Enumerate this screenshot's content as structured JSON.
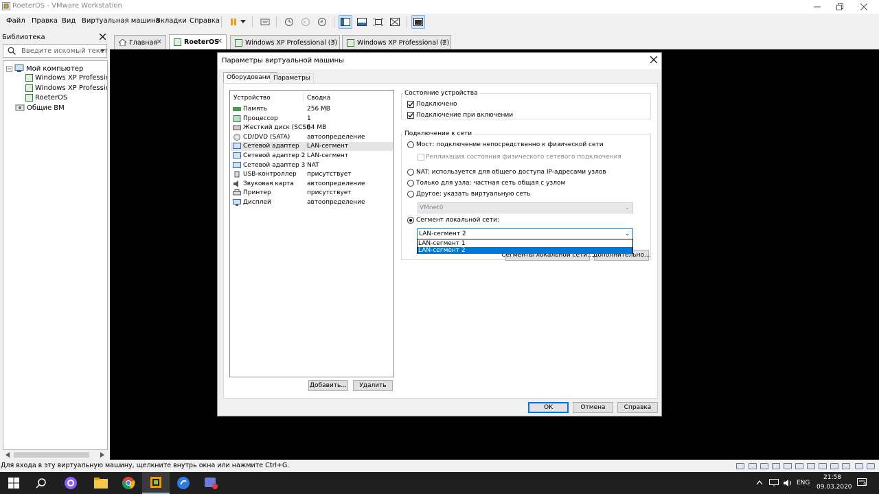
{
  "window": {
    "title": "RoeterOS - VMware Workstation"
  },
  "menu": {
    "items": [
      "Файл",
      "Правка",
      "Вид",
      "Виртуальная машина",
      "Вкладки",
      "Справка"
    ]
  },
  "library": {
    "title": "Библиотека",
    "search_placeholder": "Введите искомый текст",
    "tree": {
      "root": "Мой компьютер",
      "children": [
        "Windows XP Professional",
        "Windows XP Professional",
        "RoeterOS"
      ],
      "shared": "Общие ВМ"
    }
  },
  "tabs": [
    {
      "label": "Главная"
    },
    {
      "label": "RoeterOS"
    },
    {
      "label": "Windows XP Professional (3)"
    },
    {
      "label": "Windows XP Professional (2)"
    }
  ],
  "dialog": {
    "title": "Параметры виртуальной машины",
    "tabs": [
      "Оборудование",
      "Параметры"
    ],
    "columns": {
      "device": "Устройство",
      "summary": "Сводка"
    },
    "devices": [
      {
        "name": "Память",
        "summary": "256 MB",
        "icon": "memory-icon"
      },
      {
        "name": "Процессор",
        "summary": "1",
        "icon": "cpu-icon"
      },
      {
        "name": "Жесткий диск (SCSI)",
        "summary": "64 MB",
        "icon": "hdd-icon"
      },
      {
        "name": "CD/DVD (SATA)",
        "summary": "автоопределение",
        "icon": "cd-icon"
      },
      {
        "name": "Сетевой адаптер",
        "summary": "LAN-сегмент",
        "icon": "network-icon"
      },
      {
        "name": "Сетевой адаптер 2",
        "summary": "LAN-сегмент",
        "icon": "network-icon"
      },
      {
        "name": "Сетевой адаптер 3",
        "summary": "NAT",
        "icon": "network-icon"
      },
      {
        "name": "USB-контроллер",
        "summary": "присутствует",
        "icon": "usb-icon"
      },
      {
        "name": "Звуковая карта",
        "summary": "автоопределение",
        "icon": "sound-icon"
      },
      {
        "name": "Принтер",
        "summary": "присутствует",
        "icon": "printer-icon"
      },
      {
        "name": "Дисплей",
        "summary": "автоопределение",
        "icon": "display-icon"
      }
    ],
    "selected_device": "Сетевой адаптер",
    "add_button": "Добавить...",
    "remove_button": "Удалить",
    "device_status": {
      "title": "Состояние устройства",
      "connected": "Подключено",
      "connect_at_power_on": "Подключение при включении"
    },
    "network": {
      "title": "Подключение к сети",
      "bridged": "Мост: подключение непосредственно к физической сети",
      "replicate": "Репликация состояния физического сетевого подключения",
      "nat": "NAT: используется для общего доступа IP-адресами узлов",
      "host_only": "Только для узла: частная сеть общая с узлом",
      "custom": "Другое: указать виртуальную сеть",
      "custom_value": "VMnet0",
      "lan_segment": "Сегмент локальной сети:",
      "lan_segment_value": "LAN-сегмент 2",
      "lan_options": [
        "LAN-сегмент 1",
        "LAN-сегмент 2"
      ],
      "segments_button": "Сегменты локальной сети...",
      "advanced_button": "Дополнительно..."
    },
    "ok": "OK",
    "cancel": "Отмена",
    "help": "Справка"
  },
  "status": {
    "text": "Для входа в эту виртуальную машину, щелкните внутрь окна или нажмите Ctrl+G."
  },
  "taskbar": {
    "lang": "ENG",
    "time": "21:58",
    "date": "09.03.2020",
    "notification_count": "4"
  }
}
